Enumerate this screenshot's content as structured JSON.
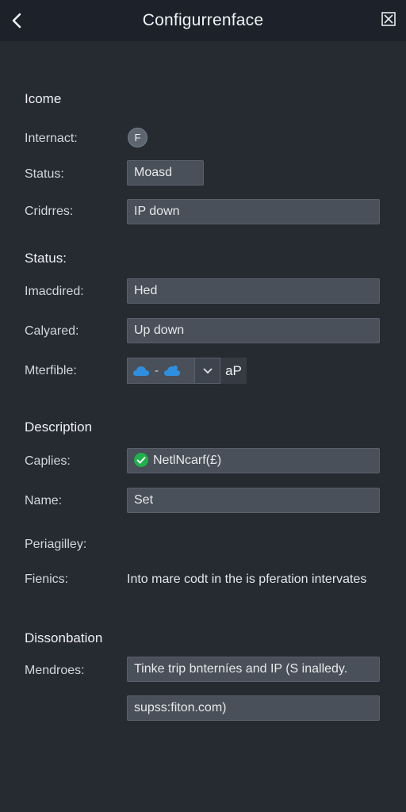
{
  "header": {
    "title": "Configurrenface"
  },
  "sections": {
    "icome": "Icome",
    "status": "Status:",
    "description": "Description",
    "dissonbation": "Dissonbation"
  },
  "labels": {
    "internact": "Internact:",
    "status": "Status:",
    "cridrres": "Cridrres:",
    "imacdired": "Imacdired:",
    "calyared": "Calyared:",
    "mterfible": "Mterfible:",
    "caplies": "Caplies:",
    "name": "Name:",
    "periagilley": "Periagilley:",
    "fienics": "Fienics:",
    "mendroes": "Mendroes:"
  },
  "values": {
    "internact_toggle": "F",
    "status": "Moasd",
    "cridrres": "IP down",
    "imacdired": "Hed",
    "calyared": "Up down",
    "mterfible_separator": "-",
    "mterfible_suffix": "aP",
    "caplies": "NetlNcarf(£)",
    "name": "Set",
    "fienics": "Into mare codt in the is pferation intervates",
    "mendroes_1": "Tinke trip bnterníes and IP (S inalledy.",
    "mendroes_2": "supss:fiton.com)"
  },
  "colors": {
    "background": "#262a31",
    "header": "#1c212a",
    "field": "#4a5059",
    "check": "#1fb24a",
    "cloud": "#2e8fe0"
  },
  "icons": {
    "back": "chevron-left-icon",
    "close": "close-box-icon",
    "cloud": "cloud-icon",
    "dropdown": "chevron-down-icon",
    "check": "check-circle-icon"
  }
}
